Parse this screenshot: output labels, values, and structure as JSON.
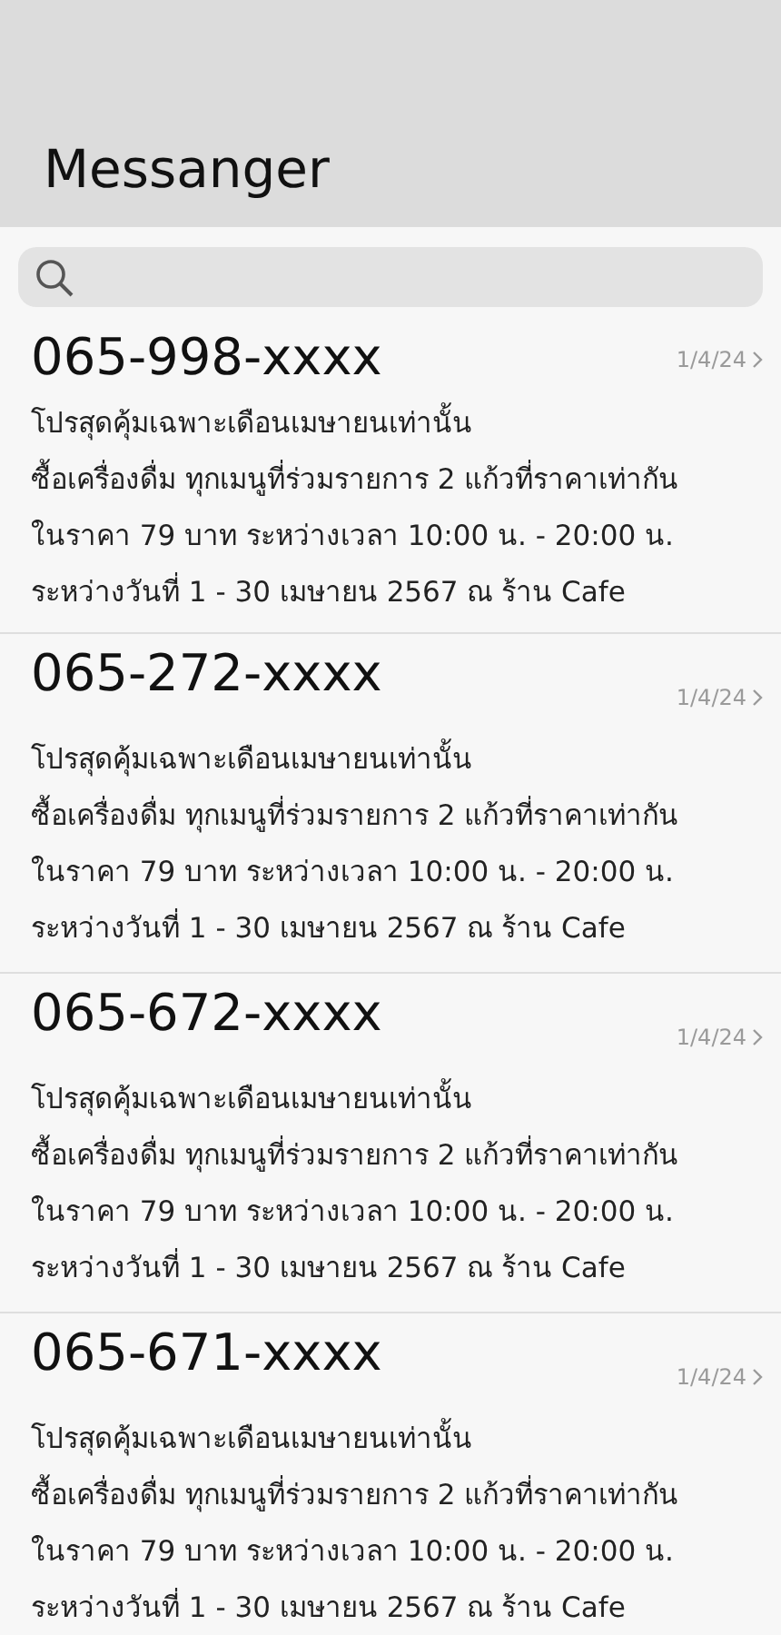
{
  "header": {
    "title": "Messanger"
  },
  "messages": [
    {
      "sender": "065-998-xxxx",
      "date": "1/4/24",
      "lines": [
        "โปรสุดคุ้มเฉพาะเดือนเมษายนเท่านั้น",
        "ซื้อเครื่องดื่ม ทุกเมนูที่ร่วมรายการ 2 แก้วที่ราคาเท่ากัน",
        "ในราคา 79 บาท ระหว่างเวลา 10:00 น. - 20:00 น.",
        "ระหว่างวันที่ 1 - 30 เมษายน 2567 ณ ร้าน Cafe"
      ]
    },
    {
      "sender": "065-272-xxxx",
      "date": "1/4/24",
      "lines": [
        "โปรสุดคุ้มเฉพาะเดือนเมษายนเท่านั้น",
        "ซื้อเครื่องดื่ม ทุกเมนูที่ร่วมรายการ 2 แก้วที่ราคาเท่ากัน",
        "ในราคา 79 บาท ระหว่างเวลา 10:00 น. - 20:00 น.",
        "ระหว่างวันที่ 1 - 30 เมษายน 2567 ณ ร้าน Cafe"
      ]
    },
    {
      "sender": "065-672-xxxx",
      "date": "1/4/24",
      "lines": [
        "โปรสุดคุ้มเฉพาะเดือนเมษายนเท่านั้น",
        "ซื้อเครื่องดื่ม ทุกเมนูที่ร่วมรายการ 2 แก้วที่ราคาเท่ากัน",
        "ในราคา 79 บาท ระหว่างเวลา 10:00 น. - 20:00 น.",
        "ระหว่างวันที่ 1 - 30 เมษายน 2567 ณ ร้าน Cafe"
      ]
    },
    {
      "sender": "065-671-xxxx",
      "date": "1/4/24",
      "lines": [
        "โปรสุดคุ้มเฉพาะเดือนเมษายนเท่านั้น",
        "ซื้อเครื่องดื่ม ทุกเมนูที่ร่วมรายการ 2 แก้วที่ราคาเท่ากัน",
        "ในราคา 79 บาท ระหว่างเวลา 10:00 น. - 20:00 น.",
        "ระหว่างวันที่ 1 - 30 เมษายน 2567 ณ ร้าน Cafe"
      ]
    }
  ]
}
